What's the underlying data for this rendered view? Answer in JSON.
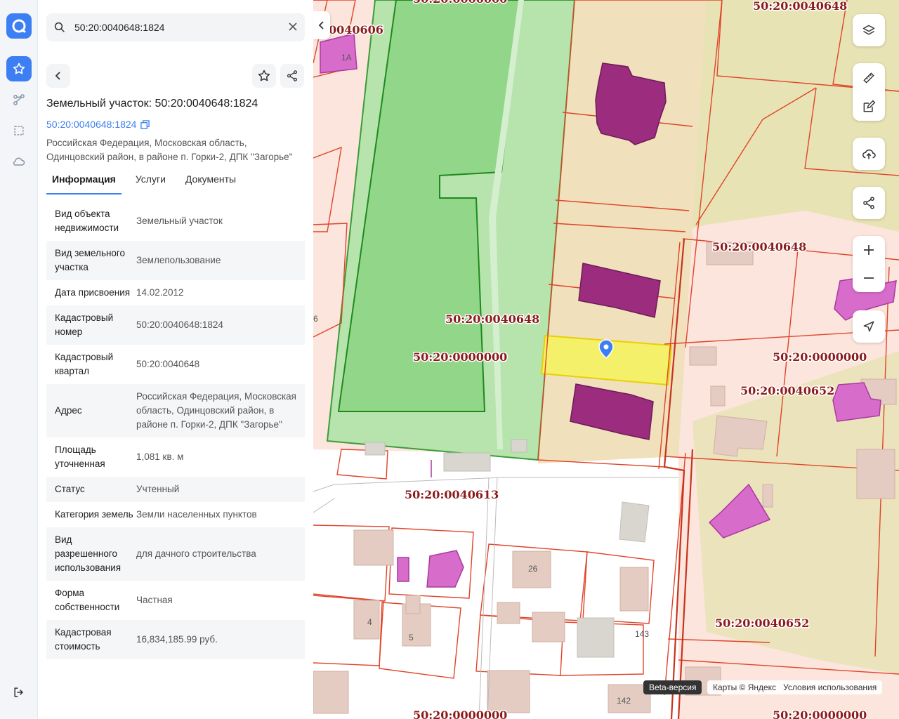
{
  "search": {
    "value": "50:20:0040648:1824",
    "placeholder": ""
  },
  "card": {
    "title": "Земельный участок: 50:20:0040648:1824",
    "cad_link": "50:20:0040648:1824",
    "address": "Российская Федерация, Московская область, Одинцовский район, в районе п. Горки-2, ДПК \"Загорье\""
  },
  "tabs": [
    {
      "label": "Информация"
    },
    {
      "label": "Услуги"
    },
    {
      "label": "Документы"
    }
  ],
  "info_rows": [
    {
      "key": "Вид объекта недвижимости",
      "value": "Земельный участок"
    },
    {
      "key": "Вид земельного участка",
      "value": "Землепользование"
    },
    {
      "key": "Дата присвоения",
      "value": "14.02.2012"
    },
    {
      "key": "Кадастровый номер",
      "value": "50:20:0040648:1824"
    },
    {
      "key": "Кадастровый квартал",
      "value": "50:20:0040648"
    },
    {
      "key": "Адрес",
      "value": "Российская Федерация, Московская область, Одинцовский район, в районе п. Горки-2, ДПК \"Загорье\""
    },
    {
      "key": "Площадь уточненная",
      "value": "1,081 кв. м"
    },
    {
      "key": "Статус",
      "value": "Учтенный"
    },
    {
      "key": "Категория земель",
      "value": "Земли населенных пунктов"
    },
    {
      "key": "Вид разрешенного использования",
      "value": "для дачного строительства"
    },
    {
      "key": "Форма собственности",
      "value": "Частная"
    },
    {
      "key": "Кадастровая стоимость",
      "value": "16,834,185.99 руб."
    }
  ],
  "map": {
    "labels": {
      "l1": "50:20:0040648",
      "l2": "0040606",
      "l3": "50:20:0040648",
      "l4": "50:20:0040648",
      "l5": "50:20:0000000",
      "l6": "50:20:0000000",
      "l7": "50:20:0040652",
      "l8": "50:20:0040613",
      "l9": "50:20:0040652",
      "l10": "50:20:0000000",
      "l11": "50:20:0000000",
      "l12": "50:20:0000000"
    },
    "house_numbers": {
      "n1": "1А",
      "n2": "6",
      "n3": "26",
      "n4": "4",
      "n5": "5",
      "n6": "143",
      "n7": "142"
    },
    "beta": "Beta-версия",
    "attribution": "Карты © Яндекс",
    "terms": "Условия использования"
  },
  "colors": {
    "accent": "#3c7ef3",
    "parcel_border": "#e0442a",
    "selected": "#f5f06a",
    "building": "#9b2c7e",
    "green": "#8fd48a"
  }
}
